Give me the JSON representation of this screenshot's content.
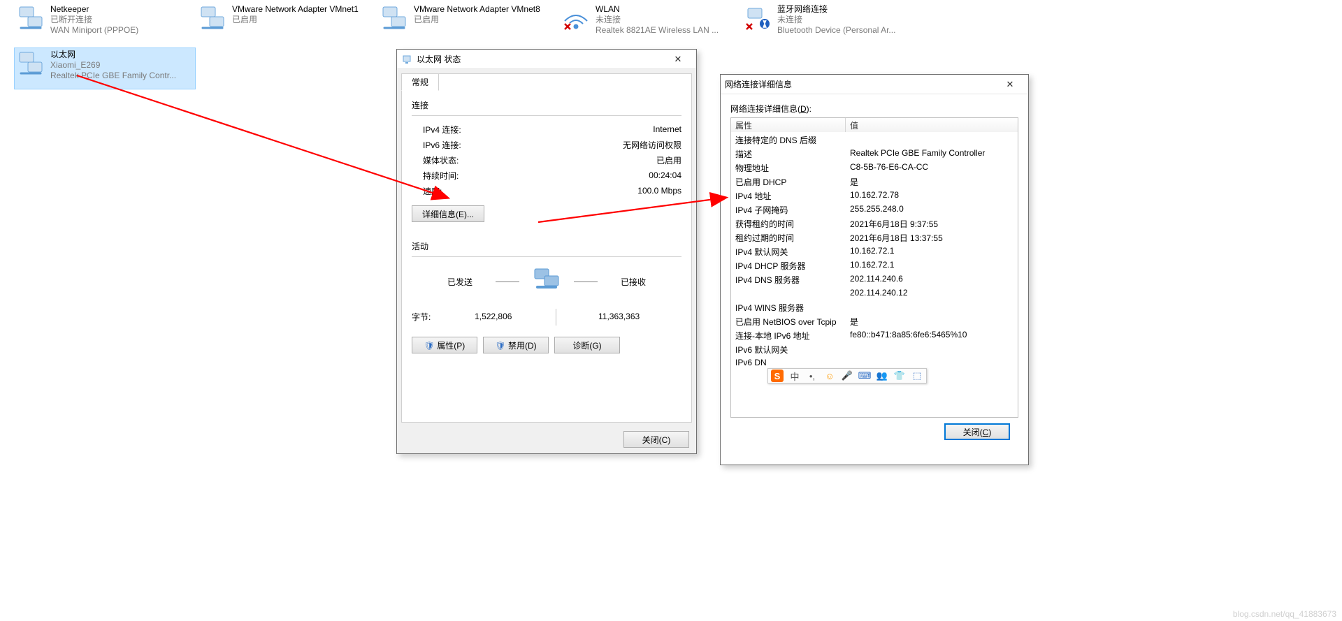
{
  "adapters": [
    {
      "name": "Netkeeper",
      "line2": "已断开连接",
      "line3": "WAN Miniport (PPPOE)",
      "selected": false,
      "cross": false,
      "kind": "wired"
    },
    {
      "name": "VMware Network Adapter VMnet1",
      "line2": "已启用",
      "line3": "",
      "selected": false,
      "cross": false,
      "kind": "wired"
    },
    {
      "name": "VMware Network Adapter VMnet8",
      "line2": "已启用",
      "line3": "",
      "selected": false,
      "cross": false,
      "kind": "wired"
    },
    {
      "name": "WLAN",
      "line2": "未连接",
      "line3": "Realtek 8821AE Wireless LAN ...",
      "selected": false,
      "cross": true,
      "kind": "wifi"
    },
    {
      "name": "蓝牙网络连接",
      "line2": "未连接",
      "line3": "Bluetooth Device (Personal Ar...",
      "selected": false,
      "cross": true,
      "kind": "bt"
    }
  ],
  "adapter_ethernet": {
    "name": "以太网",
    "line2": "Xiaomi_E269",
    "line3": "Realtek PCIe GBE Family Contr...",
    "selected": true
  },
  "status_dialog": {
    "title": "以太网 状态",
    "tab": "常规",
    "section_conn": "连接",
    "rows": [
      {
        "k": "IPv4 连接:",
        "v": "Internet"
      },
      {
        "k": "IPv6 连接:",
        "v": "无网络访问权限"
      },
      {
        "k": "媒体状态:",
        "v": "已启用"
      },
      {
        "k": "持续时间:",
        "v": "00:24:04"
      },
      {
        "k": "速度:",
        "v": "100.0 Mbps"
      }
    ],
    "details_btn": "详细信息(E)...",
    "section_act": "活动",
    "sent": "已发送",
    "recv": "已接收",
    "bytes_label": "字节:",
    "sent_bytes": "1,522,806",
    "recv_bytes": "11,363,363",
    "btns": {
      "props": "属性(P)",
      "disable": "禁用(D)",
      "diag": "诊断(G)"
    },
    "close": "关闭(C)"
  },
  "details_dialog": {
    "title": "网络连接详细信息",
    "label": "网络连接详细信息(D):",
    "header": [
      "属性",
      "值"
    ],
    "rows": [
      [
        "连接特定的 DNS 后缀",
        ""
      ],
      [
        "描述",
        "Realtek PCIe GBE Family Controller"
      ],
      [
        "物理地址",
        "C8-5B-76-E6-CA-CC"
      ],
      [
        "已启用 DHCP",
        "是"
      ],
      [
        "IPv4 地址",
        "10.162.72.78"
      ],
      [
        "IPv4 子网掩码",
        "255.255.248.0"
      ],
      [
        "获得租约的时间",
        "2021年6月18日 9:37:55"
      ],
      [
        "租约过期的时间",
        "2021年6月18日 13:37:55"
      ],
      [
        "IPv4 默认网关",
        "10.162.72.1"
      ],
      [
        "IPv4 DHCP 服务器",
        "10.162.72.1"
      ],
      [
        "IPv4 DNS 服务器",
        "202.114.240.6"
      ],
      [
        "",
        "202.114.240.12"
      ],
      [
        "IPv4 WINS 服务器",
        ""
      ],
      [
        "已启用 NetBIOS over Tcpip",
        "是"
      ],
      [
        "连接-本地 IPv6 地址",
        "fe80::b471:8a85:6fe6:5465%10"
      ],
      [
        "IPv6 默认网关",
        ""
      ],
      [
        "IPv6 DN",
        ""
      ]
    ],
    "close": "关闭(C)"
  },
  "ime": {
    "items": [
      "S",
      "中",
      "•,",
      "☺",
      "🎤",
      "⌨",
      "👥",
      "👕",
      "⬚"
    ]
  },
  "watermark": "blog.csdn.net/qq_41883673"
}
